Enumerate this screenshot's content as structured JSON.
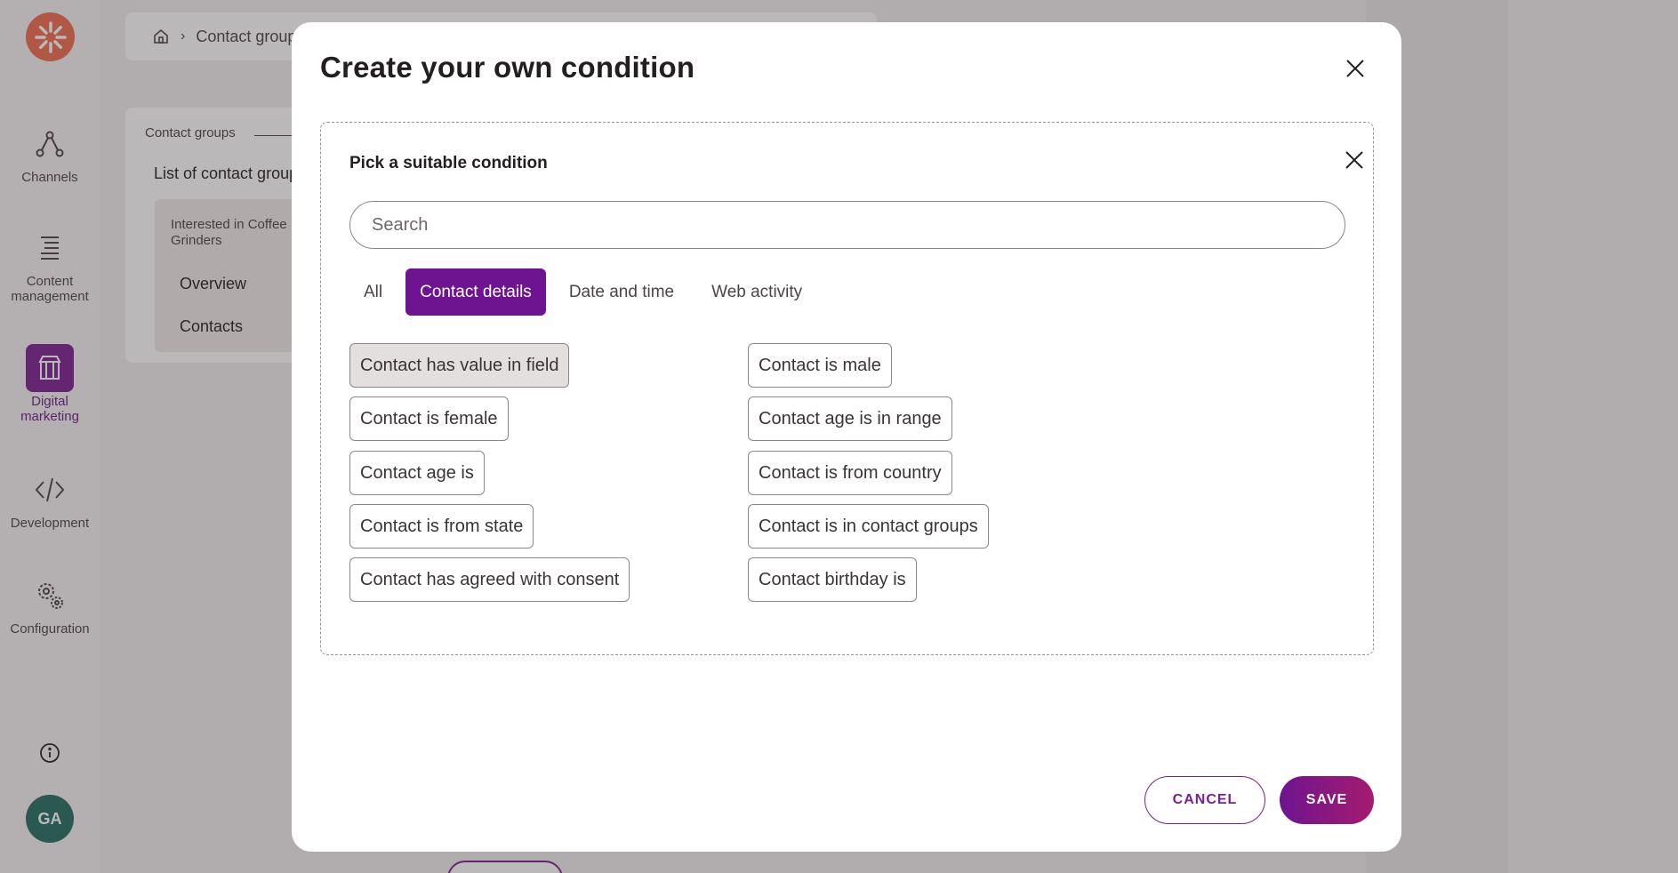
{
  "sidebar": {
    "items": [
      {
        "label": "Channels",
        "icon": "channels-icon"
      },
      {
        "label": "Content\nmanagement",
        "icon": "content-management-icon"
      },
      {
        "label": "Digital\nmarketing",
        "icon": "digital-marketing-icon"
      },
      {
        "label": "Development",
        "icon": "code-icon"
      },
      {
        "label": "Configuration",
        "icon": "gears-icon"
      }
    ],
    "avatar_initials": "GA"
  },
  "breadcrumb": {
    "current": "Contact groups"
  },
  "background_panel": {
    "section_label": "Contact groups",
    "title": "List of contact groups",
    "group_name": "Interested in Coffee Grinders",
    "links": [
      "Overview",
      "Contacts"
    ]
  },
  "modal": {
    "title": "Create your own condition",
    "picker": {
      "title": "Pick a suitable condition",
      "search_placeholder": "Search",
      "tabs": [
        {
          "label": "All",
          "active": false
        },
        {
          "label": "Contact details",
          "active": true
        },
        {
          "label": "Date and time",
          "active": false
        },
        {
          "label": "Web activity",
          "active": false
        }
      ],
      "conditions_left": [
        "Contact has value in field",
        "Contact is female",
        "Contact age is",
        "Contact is from state",
        "Contact has agreed with consent"
      ],
      "conditions_right": [
        "Contact is male",
        "Contact age is in range",
        "Contact is from country",
        "Contact is in contact groups",
        "Contact birthday is"
      ]
    },
    "cancel_label": "CANCEL",
    "save_label": "SAVE"
  },
  "colors": {
    "accent": "#6e1490",
    "logo": "#ee6b4d",
    "avatar": "#1f6e5f"
  }
}
